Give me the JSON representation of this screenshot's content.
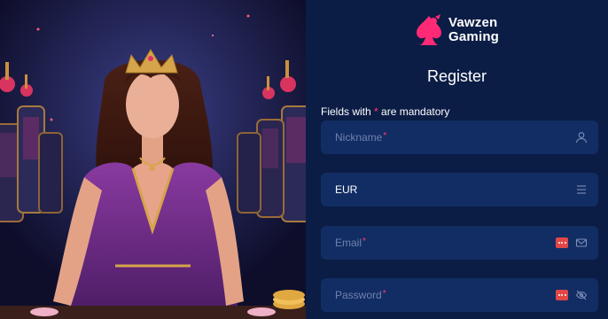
{
  "brand": {
    "name_line1": "Vawzen",
    "name_line2": "Gaming",
    "accent": "#ff2a76"
  },
  "page": {
    "title": "Register"
  },
  "form": {
    "mandatory_prefix": "Fields with ",
    "mandatory_star": "*",
    "mandatory_suffix": " are mandatory",
    "fields": [
      {
        "label": "Nickname",
        "required": "*",
        "icon": "user-icon"
      },
      {
        "label": "EUR",
        "required": "",
        "icon": "menu-icon"
      },
      {
        "label": "Email",
        "required": "*",
        "icon": "mail-icon"
      },
      {
        "label": "Password",
        "required": "*",
        "icon": "eye-off-icon"
      }
    ]
  },
  "colors": {
    "panel_bg": "#0b1d45",
    "field_bg": "#122d64",
    "placeholder": "#6f81ad",
    "required": "#ff3d6e"
  }
}
